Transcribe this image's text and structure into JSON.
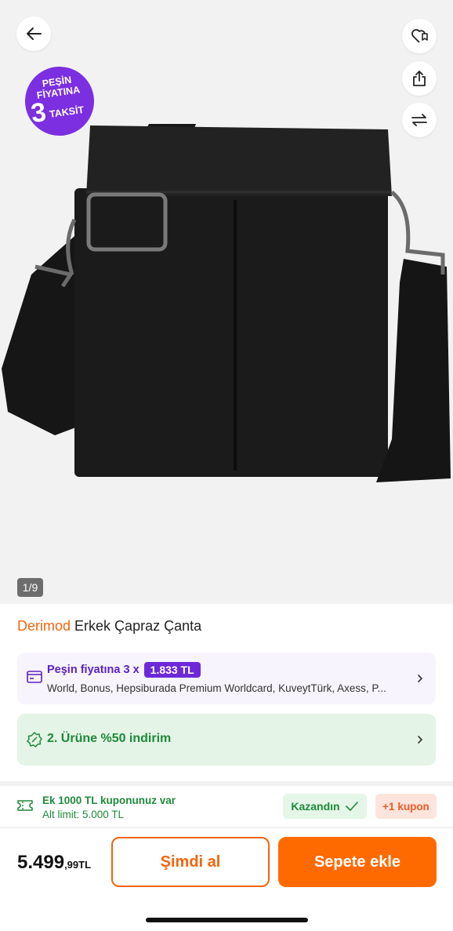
{
  "gallery": {
    "counter": "1/9",
    "promo_badge": {
      "line1": "PEŞİN",
      "line2": "FİYATINA",
      "number": "3",
      "line3": "TAKSİT"
    },
    "icons": {
      "back": "arrow-left-icon",
      "favorite": "heart-bookmark-icon",
      "share": "share-icon",
      "compare": "compare-arrows-icon"
    }
  },
  "product": {
    "brand": "Derimod",
    "name": "Erkek Çapraz Çanta"
  },
  "installment": {
    "label": "Peşin fiyatına 3 x",
    "amount": "1.833 TL",
    "cards": "World, Bonus, Hepsiburada Premium Worldcard, KuveytTürk, Axess, P..."
  },
  "discount": {
    "label": "2. Ürüne %50 indirim"
  },
  "coupon": {
    "line1": "Ek 1000 TL kuponunuz var",
    "line2": "Alt limit: 5.000 TL",
    "won_label": "Kazandın",
    "plus_label": "+1 kupon"
  },
  "checkout": {
    "price_main": "5.499",
    "price_decimal": ",99TL",
    "buy_now": "Şimdi al",
    "add_to_cart": "Sepete ekle"
  },
  "colors": {
    "brand_orange": "#f2650e",
    "cta_orange": "#ff6a00",
    "purple": "#6d28d9",
    "green": "#1e8a3a"
  }
}
